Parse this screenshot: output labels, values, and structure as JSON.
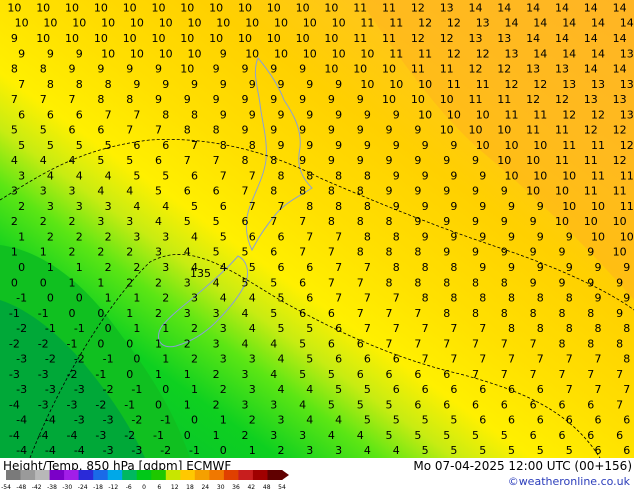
{
  "title_left": "Height/Temp. 850 hPa [gdpm] ECMWF",
  "title_right": "Mo 07-04-2025 12:00 UTC (00+156)",
  "credit": "©weatheronline.co.uk",
  "contour_label": "135",
  "colorbar": {
    "ticks": [
      "-54",
      "-48",
      "-42",
      "-38",
      "-30",
      "-24",
      "-18",
      "-12",
      "-6",
      "0",
      "6",
      "12",
      "18",
      "24",
      "30",
      "36",
      "42",
      "48",
      "54"
    ],
    "colors": [
      "#7a7a7a",
      "#9a9a9a",
      "#b8b8b8",
      "#7b00c8",
      "#a21ee8",
      "#2a2ad8",
      "#1a6ae8",
      "#00a8e8",
      "#00b860",
      "#00c818",
      "#1ec800",
      "#c8e600",
      "#ffc800",
      "#f5a000",
      "#f07800",
      "#e04000",
      "#c81e1e",
      "#a00000",
      "#600000"
    ]
  },
  "map": {
    "temperature_unit": "°C",
    "field_colors": [
      "#00b83a",
      "#0ed020",
      "#5ce614",
      "#c8ec12",
      "#fff000",
      "#ffe000",
      "#ffd000",
      "#ffc41e",
      "#ffb82e"
    ],
    "number_rows": [
      "10 10 10 10 10 10 10 10 10 10 10 10 11 11 12 13 14 14 14 14 14 14",
      "10 10 10 10 10 10 10 10 10 10 10 10 11 11 12 12 13 14 14 14 14 14",
      "9 10 10 10 10 10 10 10 10 10 10 10 11 11 12 12 13 13 14 14 14 14",
      "9 9 9 10 10 10 10 9 10 10 10 10 10 11 11 12 12 13 14 14 14 13",
      "8 8 9 9 9 9 10 9 9 9 9 10 10 10 11 11 12 12 13 13 14 14",
      "7 8 8 8 9 9 9 9 9 9 9 9 10 10 10 11 11 12 12 13 13 13",
      "7 7 7 8 8 9 9 9 9 9 9 9 9 10 10 10 11 11 12 12 13 13",
      "6 6 6 7 7 8 8 9 9 9 9 9 9 9 10 10 10 11 11 12 12 13",
      "5 5 6 6 7 7 8 8 9 9 9 9 9 9 9 10 10 10 11 11 12 12",
      "5 5 5 5 6 6 7 8 8 9 9 9 9 9 9 9 10 10 10 11 11 12",
      "4 4 4 5 5 6 7 7 8 8 9 9 9 9 9 9 9 10 10 11 11 12",
      "3 4 4 4 5 5 6 7 7 8 8 8 8 9 9 9 9 10 10 10 11 11",
      "3 3 3 4 4 5 6 6 7 8 8 8 8 9 9 9 9 9 10 10 11 11",
      "2 3 3 3 4 4 5 6 7 7 8 8 8 9 9 9 9 9 9 10 10 11",
      "2 2 2 3 3 4 5 5 6 7 7 8 8 8 9 9 9 9 9 10 10 10",
      "1 2 2 2 3 3 4 5 6 6 7 7 8 8 9 9 9 9 9 9 10 10",
      "1 1 2 2 2 3 4 5 5 6 7 7 8 8 8 9 9 9 9 9 9 10",
      "0 1 1 2 2 3 4 4 5 6 6 7 7 8 8 8 9 9 9 9 9 9",
      "0 0 1 1 2 2 3 4 5 5 6 7 7 8 8 8 8 8 9 9 9 9",
      "-1 0 0 1 1 2 3 4 4 5 6 7 7 7 8 8 8 8 8 8 9 9",
      "-1 -1 0 0 1 2 3 3 4 5 6 6 7 7 7 8 8 8 8 8 8 9",
      "-2 -1 -1 0 1 1 2 3 4 5 5 6 7 7 7 7 7 8 8 8 8 8",
      "-2 -2 -1 0 0 1 2 3 4 4 5 6 6 7 7 7 7 7 7 8 8 8",
      "-3 -2 -2 -1 0 1 2 3 3 4 5 6 6 6 7 7 7 7 7 7 7 8",
      "-3 -3 -2 -1 0 1 1 2 3 4 5 5 6 6 6 6 7 7 7 7 7 7",
      "-3 -3 -3 -2 -1 0 1 2 3 4 4 5 5 6 6 6 6 6 6 7 7 7",
      "-4 -3 -3 -2 -1 0 1 2 3 3 4 5 5 5 6 6 6 6 6 6 6 7",
      "-4 -4 -3 -3 -2 -1 0 1 2 3 4 4 5 5 5 5 6 6 6 6 6 6",
      "-4 -4 -4 -3 -2 -1 0 1 2 3 3 4 4 5 5 5 5 5 6 6 6 6",
      "-4 -4 -4 -3 -3 -2 -1 0 1 2 3 3 4 4 5 5 5 5 5 5 6 6"
    ]
  }
}
